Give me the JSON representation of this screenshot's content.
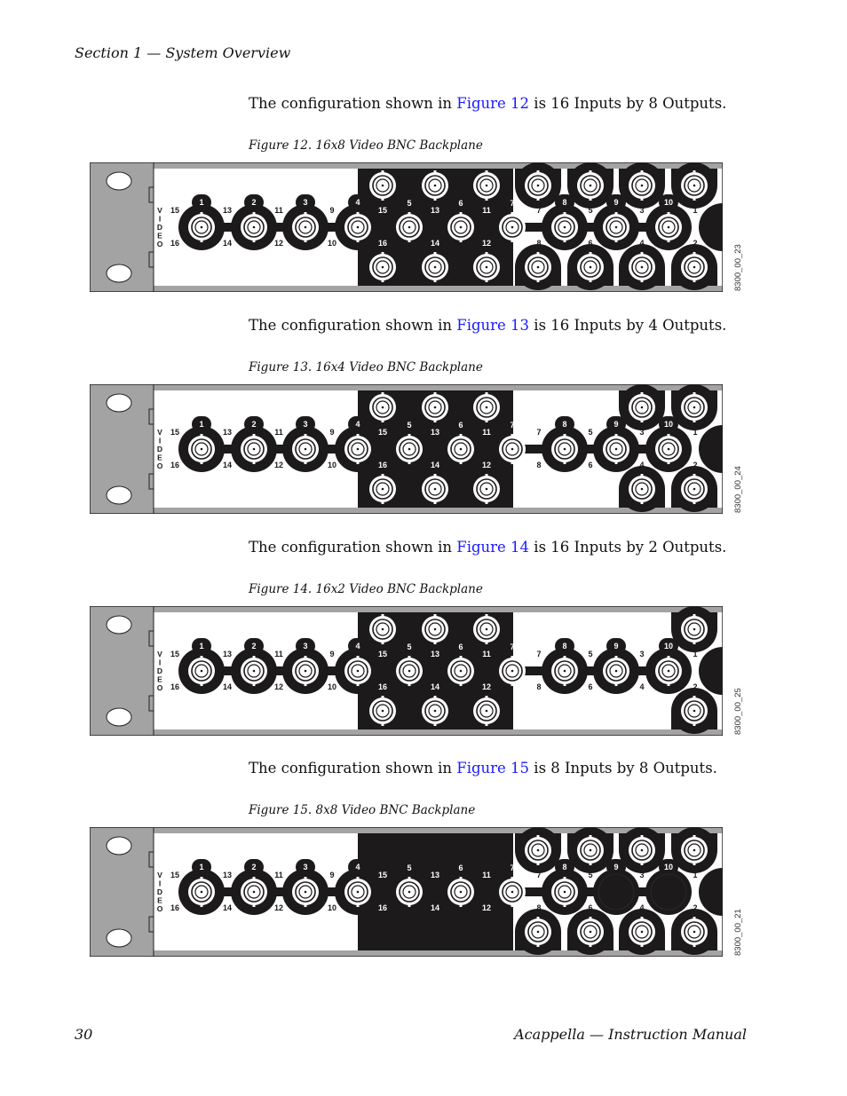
{
  "header": {
    "section": "Section 1 — System Overview"
  },
  "figures": [
    {
      "intro_before": "The configuration shown in ",
      "link": "Figure 12",
      "intro_after": " is 16 Inputs by 8 Outputs.",
      "caption": "Figure 12.  16x8 Video BNC Backplane",
      "image_id": "8300_00_23",
      "black_section_outer_rows": true,
      "right_outer_columns_populated": [
        1,
        2,
        3,
        4
      ],
      "empty_middle_connectors": []
    },
    {
      "intro_before": "The configuration shown in ",
      "link": "Figure 13",
      "intro_after": " is 16 Inputs by 4 Outputs.",
      "caption": "Figure 13.  16x4 Video BNC Backplane",
      "image_id": "8300_00_24",
      "black_section_outer_rows": true,
      "right_outer_columns_populated": [
        3,
        4
      ],
      "empty_middle_connectors": []
    },
    {
      "intro_before": "The configuration shown in ",
      "link": "Figure 14",
      "intro_after": " is 16 Inputs by 2 Outputs.",
      "caption": "Figure 14.  16x2 Video BNC Backplane",
      "image_id": "8300_00_25",
      "black_section_outer_rows": true,
      "right_outer_columns_populated": [
        4
      ],
      "empty_middle_connectors": []
    },
    {
      "intro_before": "The configuration shown in ",
      "link": "Figure 15",
      "intro_after": " is 8 Inputs by 8 Outputs.",
      "caption": "Figure 15.  8x8 Video BNC Backplane",
      "image_id": "8300_00_21",
      "black_section_outer_rows": false,
      "right_outer_columns_populated": [
        1,
        2,
        3,
        4
      ],
      "empty_middle_connectors": [
        9,
        10
      ]
    }
  ],
  "backplane": {
    "vertical_label": "VIDEO",
    "connector_numbers": [
      "1",
      "2",
      "3",
      "4",
      "5",
      "6",
      "7",
      "8",
      "9",
      "10"
    ],
    "upper_labels": [
      "15",
      "13",
      "11",
      "9",
      "15",
      "13",
      "11",
      "7",
      "5",
      "3",
      "1"
    ],
    "lower_labels": [
      "16",
      "14",
      "12",
      "10",
      "16",
      "14",
      "12",
      "8",
      "6",
      "4",
      "2"
    ],
    "colors": {
      "bezel": "#a3a3a3",
      "black": "#1c1a1a",
      "link": "#1a1aff"
    }
  },
  "footer": {
    "page_number": "30",
    "title": "Acappella  —  Instruction Manual"
  }
}
